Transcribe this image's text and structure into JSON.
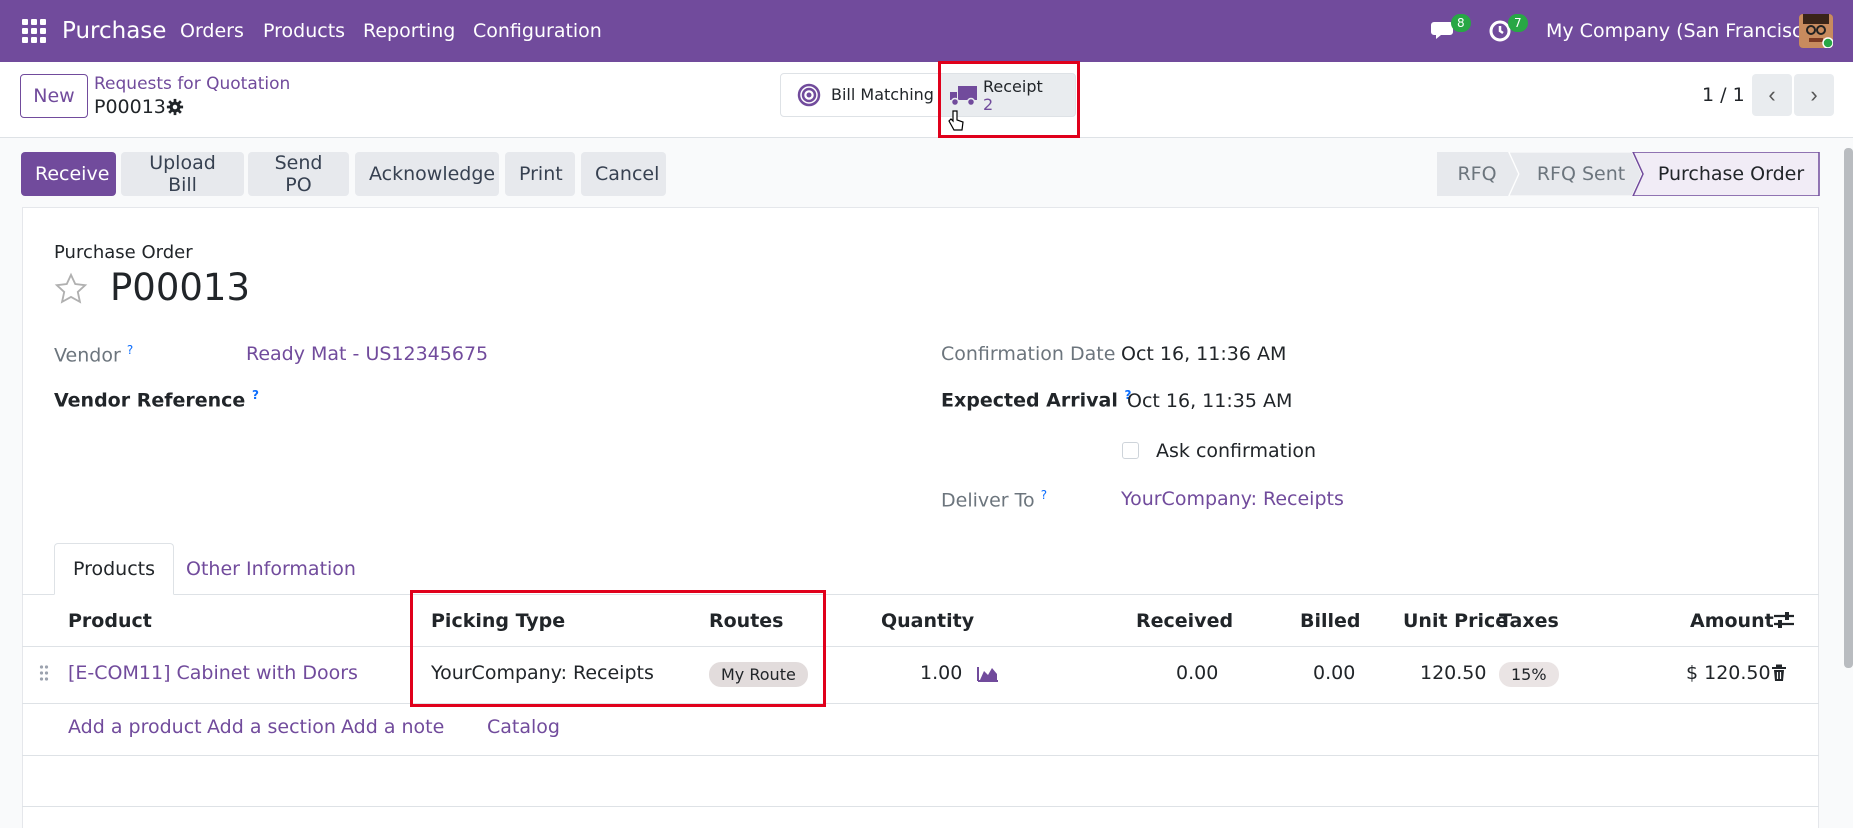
{
  "nav": {
    "brand": "Purchase",
    "menu": [
      "Orders",
      "Products",
      "Reporting",
      "Configuration"
    ],
    "messages_count": "8",
    "activities_count": "7",
    "company": "My Company (San Francisco)"
  },
  "control": {
    "new_label": "New",
    "breadcrumb_parent": "Requests for Quotation",
    "breadcrumb_current": "P00013",
    "bill_matching_label": "Bill Matching",
    "receipt_label": "Receipt",
    "receipt_count": "2",
    "pager": "1 / 1"
  },
  "actions": [
    "Receive",
    "Upload Bill",
    "Send PO",
    "Acknowledge",
    "Print",
    "Cancel"
  ],
  "stages": [
    "RFQ",
    "RFQ Sent",
    "Purchase Order"
  ],
  "form": {
    "type_label": "Purchase Order",
    "name": "P00013",
    "vendor_label": "Vendor",
    "vendor_value": "Ready Mat - US12345675",
    "vendor_ref_label": "Vendor Reference",
    "confirmation_label": "Confirmation Date",
    "confirmation_value": "Oct 16, 11:36 AM",
    "expected_label": "Expected Arrival",
    "expected_value": "Oct 16, 11:35 AM",
    "ask_confirmation_label": "Ask confirmation",
    "deliver_label": "Deliver To",
    "deliver_value": "YourCompany: Receipts",
    "help_mark": "?"
  },
  "tabs": [
    "Products",
    "Other Information"
  ],
  "table": {
    "headers": [
      "Product",
      "Picking Type",
      "Routes",
      "Quantity",
      "Received",
      "Billed",
      "Unit Price",
      "Taxes",
      "Amount"
    ],
    "row": {
      "product": "[E-COM11] Cabinet with Doors",
      "picking_type": "YourCompany: Receipts",
      "route": "My Route",
      "quantity": "1.00",
      "received": "0.00",
      "billed": "0.00",
      "unit_price": "120.50",
      "taxes": "15%",
      "amount": "$ 120.50"
    },
    "add_links": [
      "Add a product",
      "Add a section",
      "Add a note",
      "Catalog"
    ]
  },
  "colors": {
    "brand": "#714b9c",
    "highlight": "#e0001b"
  }
}
